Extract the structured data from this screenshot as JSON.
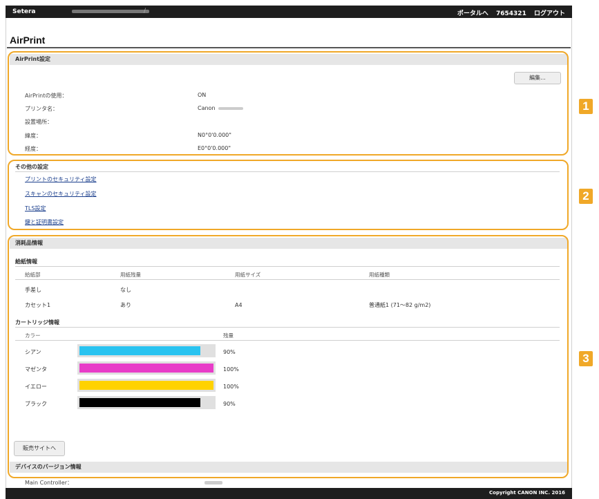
{
  "topbar": {
    "brand": "Setera",
    "crumb_sep": "/",
    "portal_link": "ポータルへ",
    "user_id": "7654321",
    "logout": "ログアウト"
  },
  "page_title": "AirPrint",
  "airprint_settings": {
    "header": "AirPrint設定",
    "edit_button": "編集...",
    "rows": [
      {
        "label": "AirPrintの使用：",
        "value": "ON"
      },
      {
        "label": "プリンタ名：",
        "value": "Canon"
      },
      {
        "label": "設置場所：",
        "value": ""
      },
      {
        "label": "緯度：",
        "value": "N0°0'0.000\""
      },
      {
        "label": "経度：",
        "value": "E0°0'0.000\""
      }
    ]
  },
  "other_settings": {
    "header": "その他の設定",
    "links": [
      "プリントのセキュリティ設定",
      "スキャンのセキュリティ設定",
      "TLS設定",
      "鍵と証明書設定"
    ]
  },
  "consumables": {
    "header": "消耗品情報",
    "paper_info": {
      "title": "給紙情報",
      "columns": [
        "給紙部",
        "用紙残量",
        "用紙サイズ",
        "用紙種類"
      ],
      "rows": [
        [
          "手差し",
          "なし",
          "",
          ""
        ],
        [
          "カセット1",
          "あり",
          "A4",
          "普通紙1 (71～82 g/m2)"
        ]
      ]
    },
    "cartridge_info": {
      "title": "カートリッジ情報",
      "col_color": "カラー",
      "col_remaining": "残量",
      "items": [
        {
          "name": "シアン",
          "percent": "90%",
          "level": 0.9,
          "color": "#29c3f0"
        },
        {
          "name": "マゼンタ",
          "percent": "100%",
          "level": 1.0,
          "color": "#e83cc8"
        },
        {
          "name": "イエロー",
          "percent": "100%",
          "level": 1.0,
          "color": "#ffd200"
        },
        {
          "name": "ブラック",
          "percent": "90%",
          "level": 0.9,
          "color": "#000000"
        }
      ]
    },
    "shop_button": "販売サイトへ"
  },
  "device_version": {
    "header": "デバイスのバージョン情報",
    "rows": [
      {
        "label": "Main Controller：",
        "value": ""
      }
    ]
  },
  "highlights": [
    {
      "number": "1"
    },
    {
      "number": "2"
    },
    {
      "number": "3"
    }
  ],
  "footer": {
    "copyright": "Copyright CANON INC. 2016"
  },
  "colors": {
    "highlight": "#f0a828",
    "link": "#1a3e8c",
    "topbar": "#1e1e1e"
  }
}
